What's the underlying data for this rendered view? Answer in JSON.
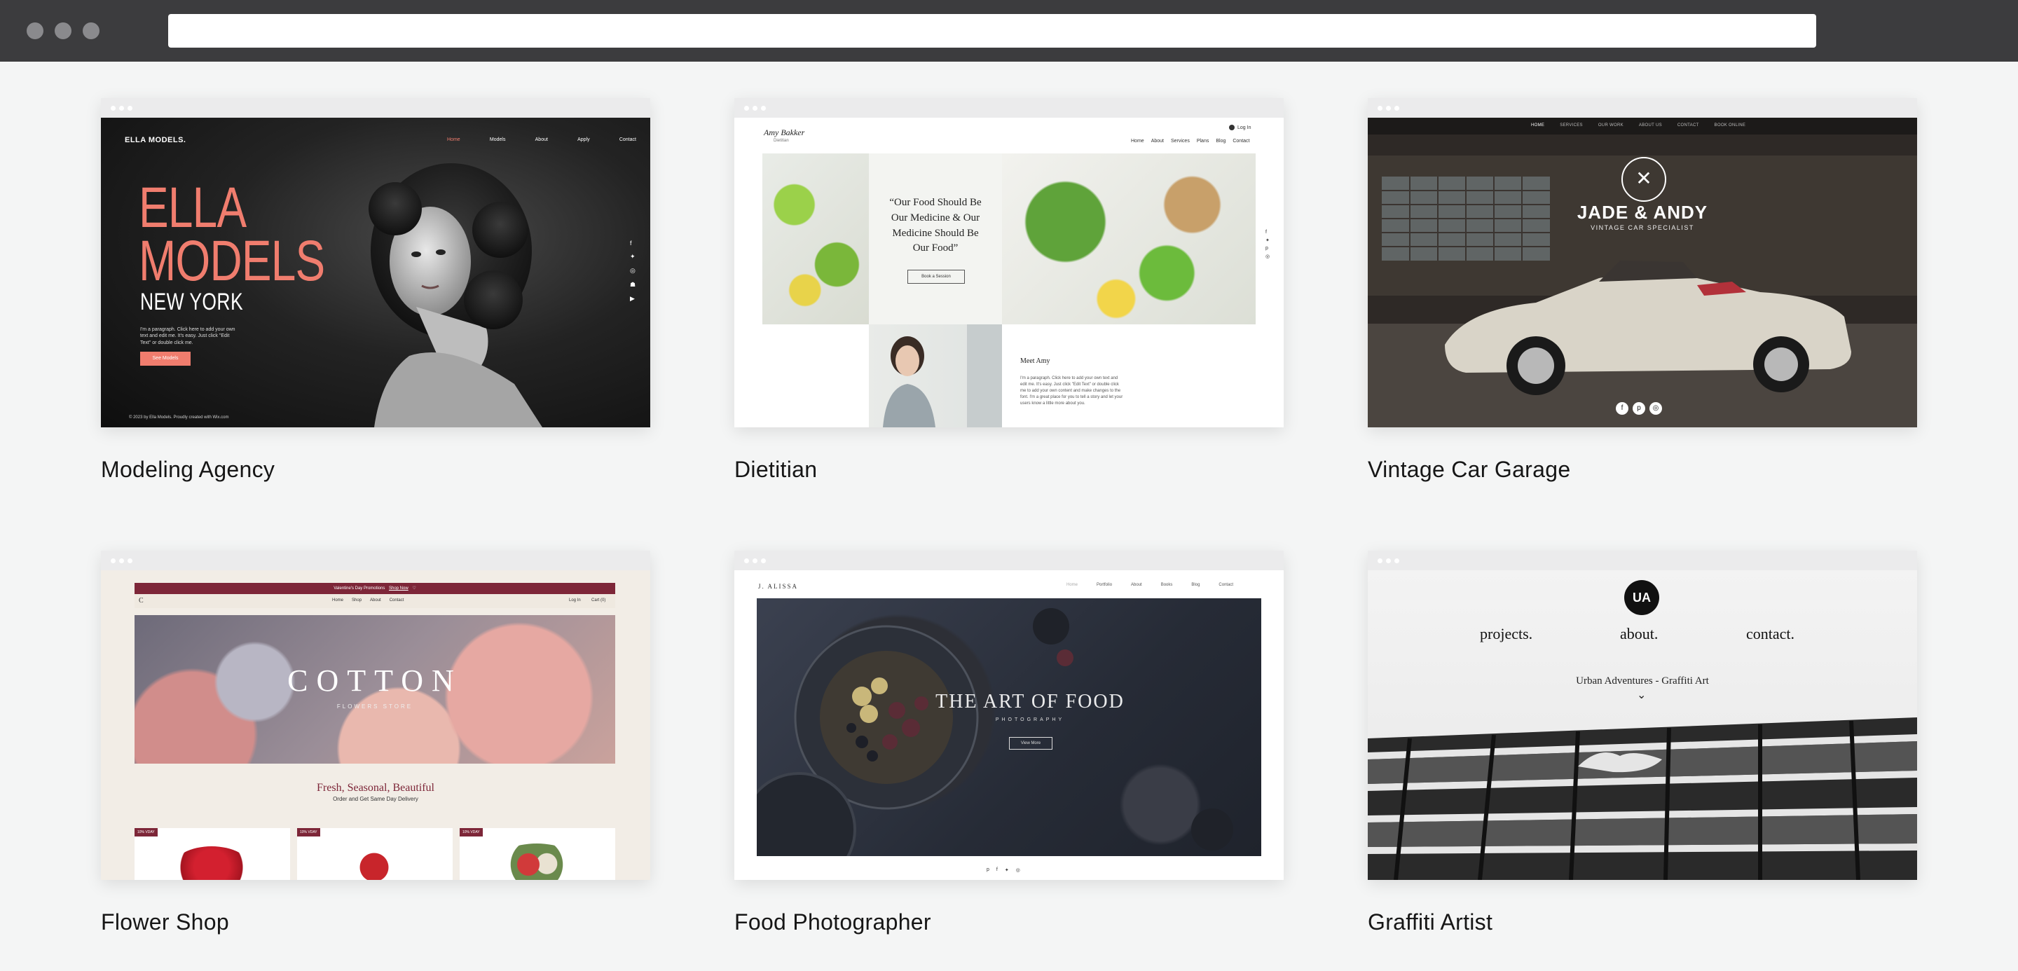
{
  "templates": [
    {
      "title": "Modeling Agency",
      "nav": [
        "Home",
        "Models",
        "About",
        "Apply",
        "Contact"
      ],
      "logo": "ELLA MODELS.",
      "hero_line1": "ELLA",
      "hero_line2": "MODELS",
      "hero_line3": "NEW YORK",
      "paragraph": "I'm a paragraph. Click here to add your own text and edit me. It's easy. Just click \"Edit Text\" or double click me.",
      "button": "See Models",
      "footer": "© 2023 by Ella Models. Proudly created with Wix.com",
      "social_icons": [
        "facebook-icon",
        "twitter-icon",
        "instagram-icon",
        "snapchat-icon",
        "youtube-icon"
      ]
    },
    {
      "title": "Dietitian",
      "logo": "Amy Bakker",
      "logo_sub": "Dietitian",
      "login": "Log In",
      "nav": [
        "Home",
        "About",
        "Services",
        "Plans",
        "Blog",
        "Contact"
      ],
      "quote": "“Our Food Should Be Our Medicine & Our Medicine Should Be Our Food”",
      "button": "Book a Session",
      "meet_title": "Meet Amy",
      "meet_text": "I'm a paragraph. Click here to add your own text and edit me. It's easy. Just click \"Edit Text\" or double click me to add your own content and make changes to the font. I'm a great place for you to tell a story and let your users know a little more about you."
    },
    {
      "title": "Vintage Car Garage",
      "nav": [
        "HOME",
        "SERVICES",
        "OUR WORK",
        "ABOUT US",
        "CONTACT",
        "BOOK ONLINE"
      ],
      "brand": "JADE & ANDY",
      "tagline": "VINTAGE CAR SPECIALIST",
      "social_icons": [
        "facebook-icon",
        "pinterest-icon",
        "instagram-icon"
      ]
    },
    {
      "title": "Flower Shop",
      "promo": "Valentine's Day Promotions",
      "promo_link": "Shop Now",
      "nav": [
        "Home",
        "Shop",
        "About",
        "Contact"
      ],
      "login": "Log In",
      "cart": "Cart (0)",
      "logo_letter": "C",
      "hero": "COTTON",
      "hero_sub": "FLOWERS STORE",
      "headline": "Fresh, Seasonal, Beautiful",
      "subline": "Order and Get Same Day Delivery",
      "badges": [
        "10% VDAY",
        "10% VDAY",
        "10% VDAY"
      ]
    },
    {
      "title": "Food Photographer",
      "logo": "J. ALISSA",
      "nav": [
        "Home",
        "Portfolio",
        "About",
        "Books",
        "Blog",
        "Contact"
      ],
      "hero": "THE ART OF FOOD",
      "hero_sub": "PHOTOGRAPHY",
      "button": "View More",
      "social_icons": [
        "pinterest-icon",
        "facebook-icon",
        "twitter-icon",
        "instagram-icon"
      ]
    },
    {
      "title": "Graffiti Artist",
      "logo": "UA",
      "nav": [
        "projects.",
        "about.",
        "contact."
      ],
      "caption": "Urban Adventures - Graffiti Art"
    }
  ]
}
